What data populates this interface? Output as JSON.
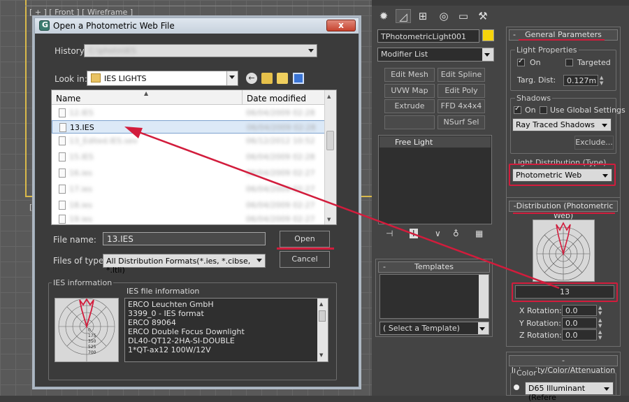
{
  "viewport": {
    "label": "[ + ] [ Front ] [ Wireframe ]",
    "label2": "["
  },
  "dialog": {
    "title": "Open a Photometric Web File",
    "close": "x",
    "history_label": "History:",
    "history_value": "C:\\photo\\IES",
    "lookin_label": "Look in:",
    "lookin_value": "IES LIGHTS",
    "columns": {
      "name": "Name",
      "date": "Date modified"
    },
    "files": [
      {
        "name": "12.IES",
        "date": "06/04/2009 02:28"
      },
      {
        "name": "13.IES",
        "date": "06/04/2009 02:28"
      },
      {
        "name": "13_Edited.IES.sev",
        "date": "06/12/2012 10:52"
      },
      {
        "name": "15.IES",
        "date": "06/04/2009 02:28"
      },
      {
        "name": "16.ies",
        "date": "06/04/2009 02:27"
      },
      {
        "name": "17.ies",
        "date": "06/04/2009 02:27"
      },
      {
        "name": "18.ies",
        "date": "06/04/2009 02:27"
      },
      {
        "name": "19.ies",
        "date": "06/04/2009 02:27"
      }
    ],
    "filename_label": "File name:",
    "filename_value": "13.IES",
    "filetype_label": "Files of type:",
    "filetype_value": "All Distribution Formats(*.ies, *.cibse, *.ltli)",
    "open_btn": "Open",
    "cancel_btn": "Cancel",
    "ies_group": "IES information",
    "ies_file_info_label": "IES file information",
    "ies_lines": [
      "ERCO Leuchten GmbH",
      "3399_0 - IES format",
      "ERCO 89064",
      "ERCO Double Focus Downlight",
      "DL40-QT12-2HA-SI-DOUBLE",
      "1*QT-ax12 100W/12V"
    ],
    "polar_ticks": [
      "0",
      "175",
      "350",
      "525",
      "700"
    ]
  },
  "panel": {
    "object_name": "TPhotometricLight001",
    "modifier_list": "Modifier List",
    "buttons": [
      "Edit Mesh",
      "Edit Spline",
      "UVW Map",
      "Edit Poly",
      "Extrude",
      "FFD 4x4x4",
      "",
      "NSurf Sel"
    ],
    "stack_item": "Free Light",
    "templates_title": "Templates",
    "templates_select": "( Select a Template)",
    "minus": "-",
    "general_title": "General Parameters",
    "light_props": "Light Properties",
    "on_label": "On",
    "targeted_label": "Targeted",
    "targ_dist_label": "Targ. Dist:",
    "targ_dist_value": "0.127m",
    "shadows": "Shadows",
    "shadows_on": "On",
    "use_global": "Use Global Settings",
    "shadow_type": "Ray Traced Shadows",
    "exclude": "Exclude...",
    "light_dist": "Light Distribution (Type)",
    "light_dist_value": "Photometric Web",
    "dist_title": "Distribution (Photometric Web)",
    "web_name": "13",
    "x_rot_label": "X Rotation:",
    "x_rot": "0.0",
    "y_rot_label": "Y Rotation:",
    "y_rot": "0.0",
    "z_rot_label": "Z Rotation:",
    "z_rot": "0.0",
    "icc_title": "Intensity/Color/Attenuation",
    "color_label": "Color",
    "color_value": "D65 Illuminant (Refere"
  },
  "colors": {
    "annotation": "#d21c3c",
    "object_color": "#f7d40a",
    "selected_row": "#dce9f7"
  }
}
